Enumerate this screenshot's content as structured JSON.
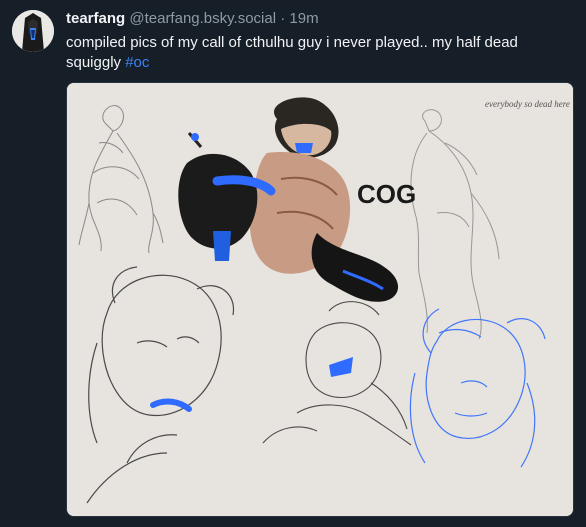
{
  "post": {
    "author": {
      "display_name": "tearfang",
      "handle": "@tearfang.bsky.social"
    },
    "separator": "·",
    "timestamp": "19m",
    "text": "compiled pics of my call of cthulhu guy i never played.. my half dead squiggly ",
    "hashtag": "#oc",
    "image": {
      "sketch_text_logo": "COG",
      "sketch_note": "everybody so dead here"
    }
  },
  "colors": {
    "background": "#161e27",
    "text_primary": "#f1f3f5",
    "text_secondary": "#8d9aa8",
    "link": "#3b82f6",
    "image_paper": "#e7e3de",
    "sketch_blue": "#2f6bff"
  },
  "icons": {
    "avatar": "avatar-image"
  }
}
